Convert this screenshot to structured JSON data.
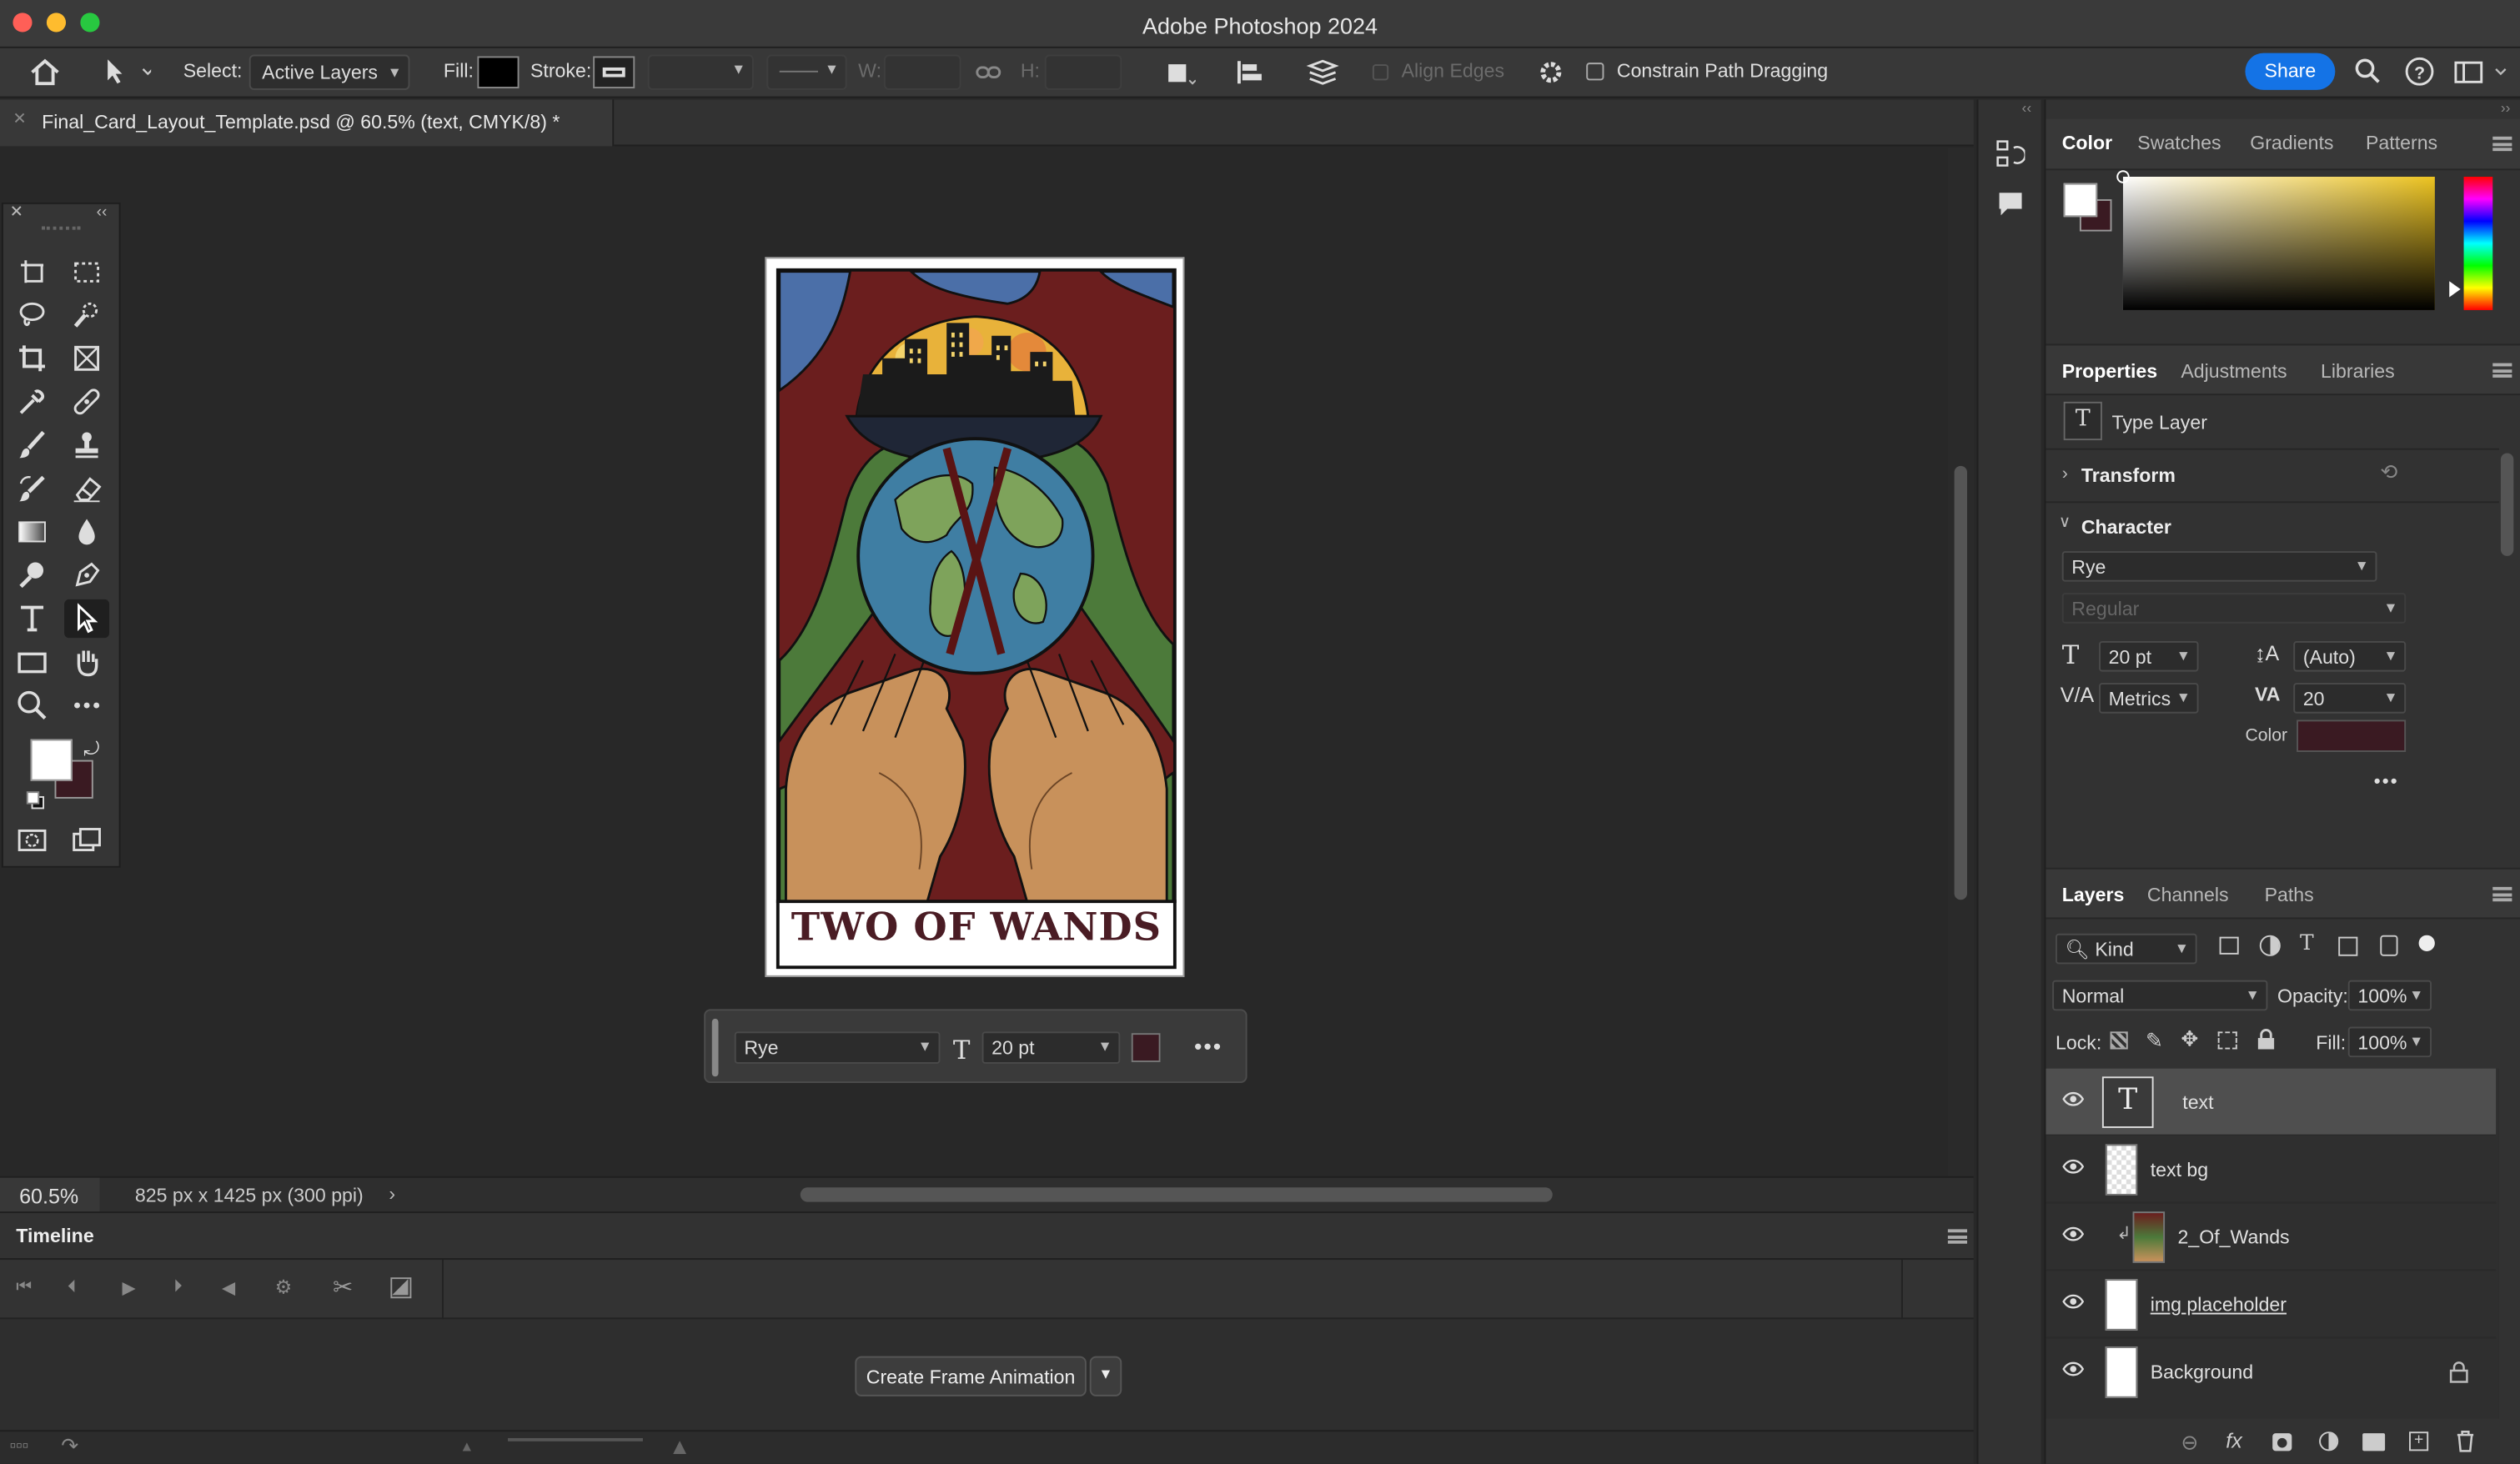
{
  "window": {
    "title": "Adobe Photoshop 2024"
  },
  "options_bar": {
    "select_label": "Select:",
    "select_value": "Active Layers",
    "fill_label": "Fill:",
    "stroke_label": "Stroke:",
    "w_label": "W:",
    "h_label": "H:",
    "align_edges_label": "Align Edges",
    "constrain_label": "Constrain Path Dragging",
    "share_label": "Share"
  },
  "document": {
    "tab_title": "Final_Card_Layout_Template.psd @ 60.5% (text, CMYK/8) *"
  },
  "card": {
    "title_text": "TWO OF WANDS"
  },
  "contextual_bar": {
    "font": "Rye",
    "size": "20 pt",
    "color": "#3a1a22"
  },
  "status": {
    "zoom": "60.5%",
    "doc_info": "825 px x 1425 px (300 ppi)"
  },
  "timeline": {
    "title": "Timeline",
    "create_label": "Create Frame Animation"
  },
  "color_panel": {
    "tabs": [
      "Color",
      "Swatches",
      "Gradients",
      "Patterns"
    ],
    "foreground": "#ffffff",
    "background": "#3a1a22"
  },
  "properties_panel": {
    "tabs": [
      "Properties",
      "Adjustments",
      "Libraries"
    ],
    "layer_type": "Type Layer",
    "transform_label": "Transform",
    "character_label": "Character",
    "font_family": "Rye",
    "font_style": "Regular",
    "font_size": "20 pt",
    "leading": "(Auto)",
    "kerning": "Metrics",
    "tracking": "20",
    "color_label": "Color",
    "text_color": "#3a1a22"
  },
  "layers_panel": {
    "tabs": [
      "Layers",
      "Channels",
      "Paths"
    ],
    "filter": "Kind",
    "blend_mode": "Normal",
    "opacity_label": "Opacity:",
    "opacity": "100%",
    "lock_label": "Lock:",
    "fill_label": "Fill:",
    "fill": "100%",
    "layers": [
      {
        "name": "text",
        "selected": true
      },
      {
        "name": "text bg",
        "selected": false
      },
      {
        "name": "2_Of_Wands",
        "selected": false
      },
      {
        "name": "img placeholder",
        "selected": false
      },
      {
        "name": "Background",
        "selected": false
      }
    ]
  }
}
